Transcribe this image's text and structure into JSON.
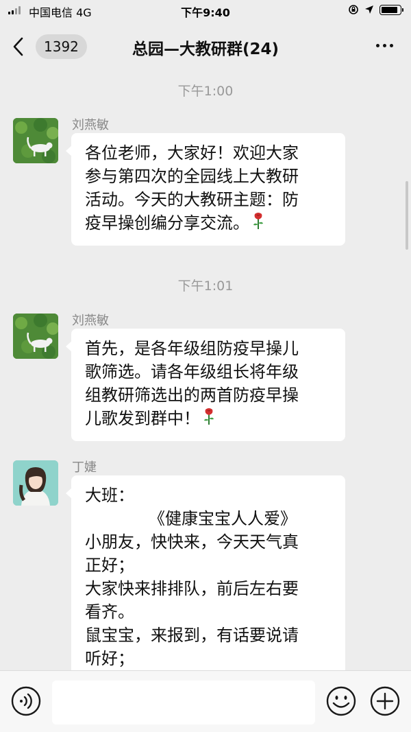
{
  "status": {
    "carrier": "中国电信 4G",
    "time": "下午9:40",
    "battery_level": 0.9
  },
  "header": {
    "back_count": "1392",
    "title": "总园—大教研群(24)",
    "icons": {
      "back": "chevron-left-icon",
      "more": "more-dots-icon"
    }
  },
  "chat": {
    "timestamps": [
      "下午1:00",
      "下午1:01"
    ],
    "messages": [
      {
        "sender": "刘燕敏",
        "avatar": "cat-avatar",
        "lines": [
          "各位老师，大家好！欢迎大家",
          "参与第四次的全园线上大教研",
          "活动。今天的大教研主题：防",
          "疫早操创编分享交流。"
        ],
        "emoji": "rose-emoji"
      },
      {
        "sender": "刘燕敏",
        "avatar": "cat-avatar",
        "lines": [
          "首先，是各年级组防疫早操儿",
          "歌筛选。请各年级组长将年级",
          "组教研筛选出的两首防疫早操",
          "儿歌发到群中！"
        ],
        "emoji": "rose-emoji"
      },
      {
        "sender": "丁婕",
        "avatar": "girl-avatar",
        "lines": [
          "大班：",
          "《健康宝宝人人爱》",
          "小朋友，快快来，今天天气真",
          "正好；",
          "大家快来排排队，前后左右要",
          "看齐。",
          "鼠宝宝，来报到，有话要说请",
          "听好；"
        ]
      }
    ]
  },
  "input_bar": {
    "icons": {
      "voice": "voice-icon",
      "emoji": "emoji-icon",
      "plus": "plus-icon"
    }
  }
}
